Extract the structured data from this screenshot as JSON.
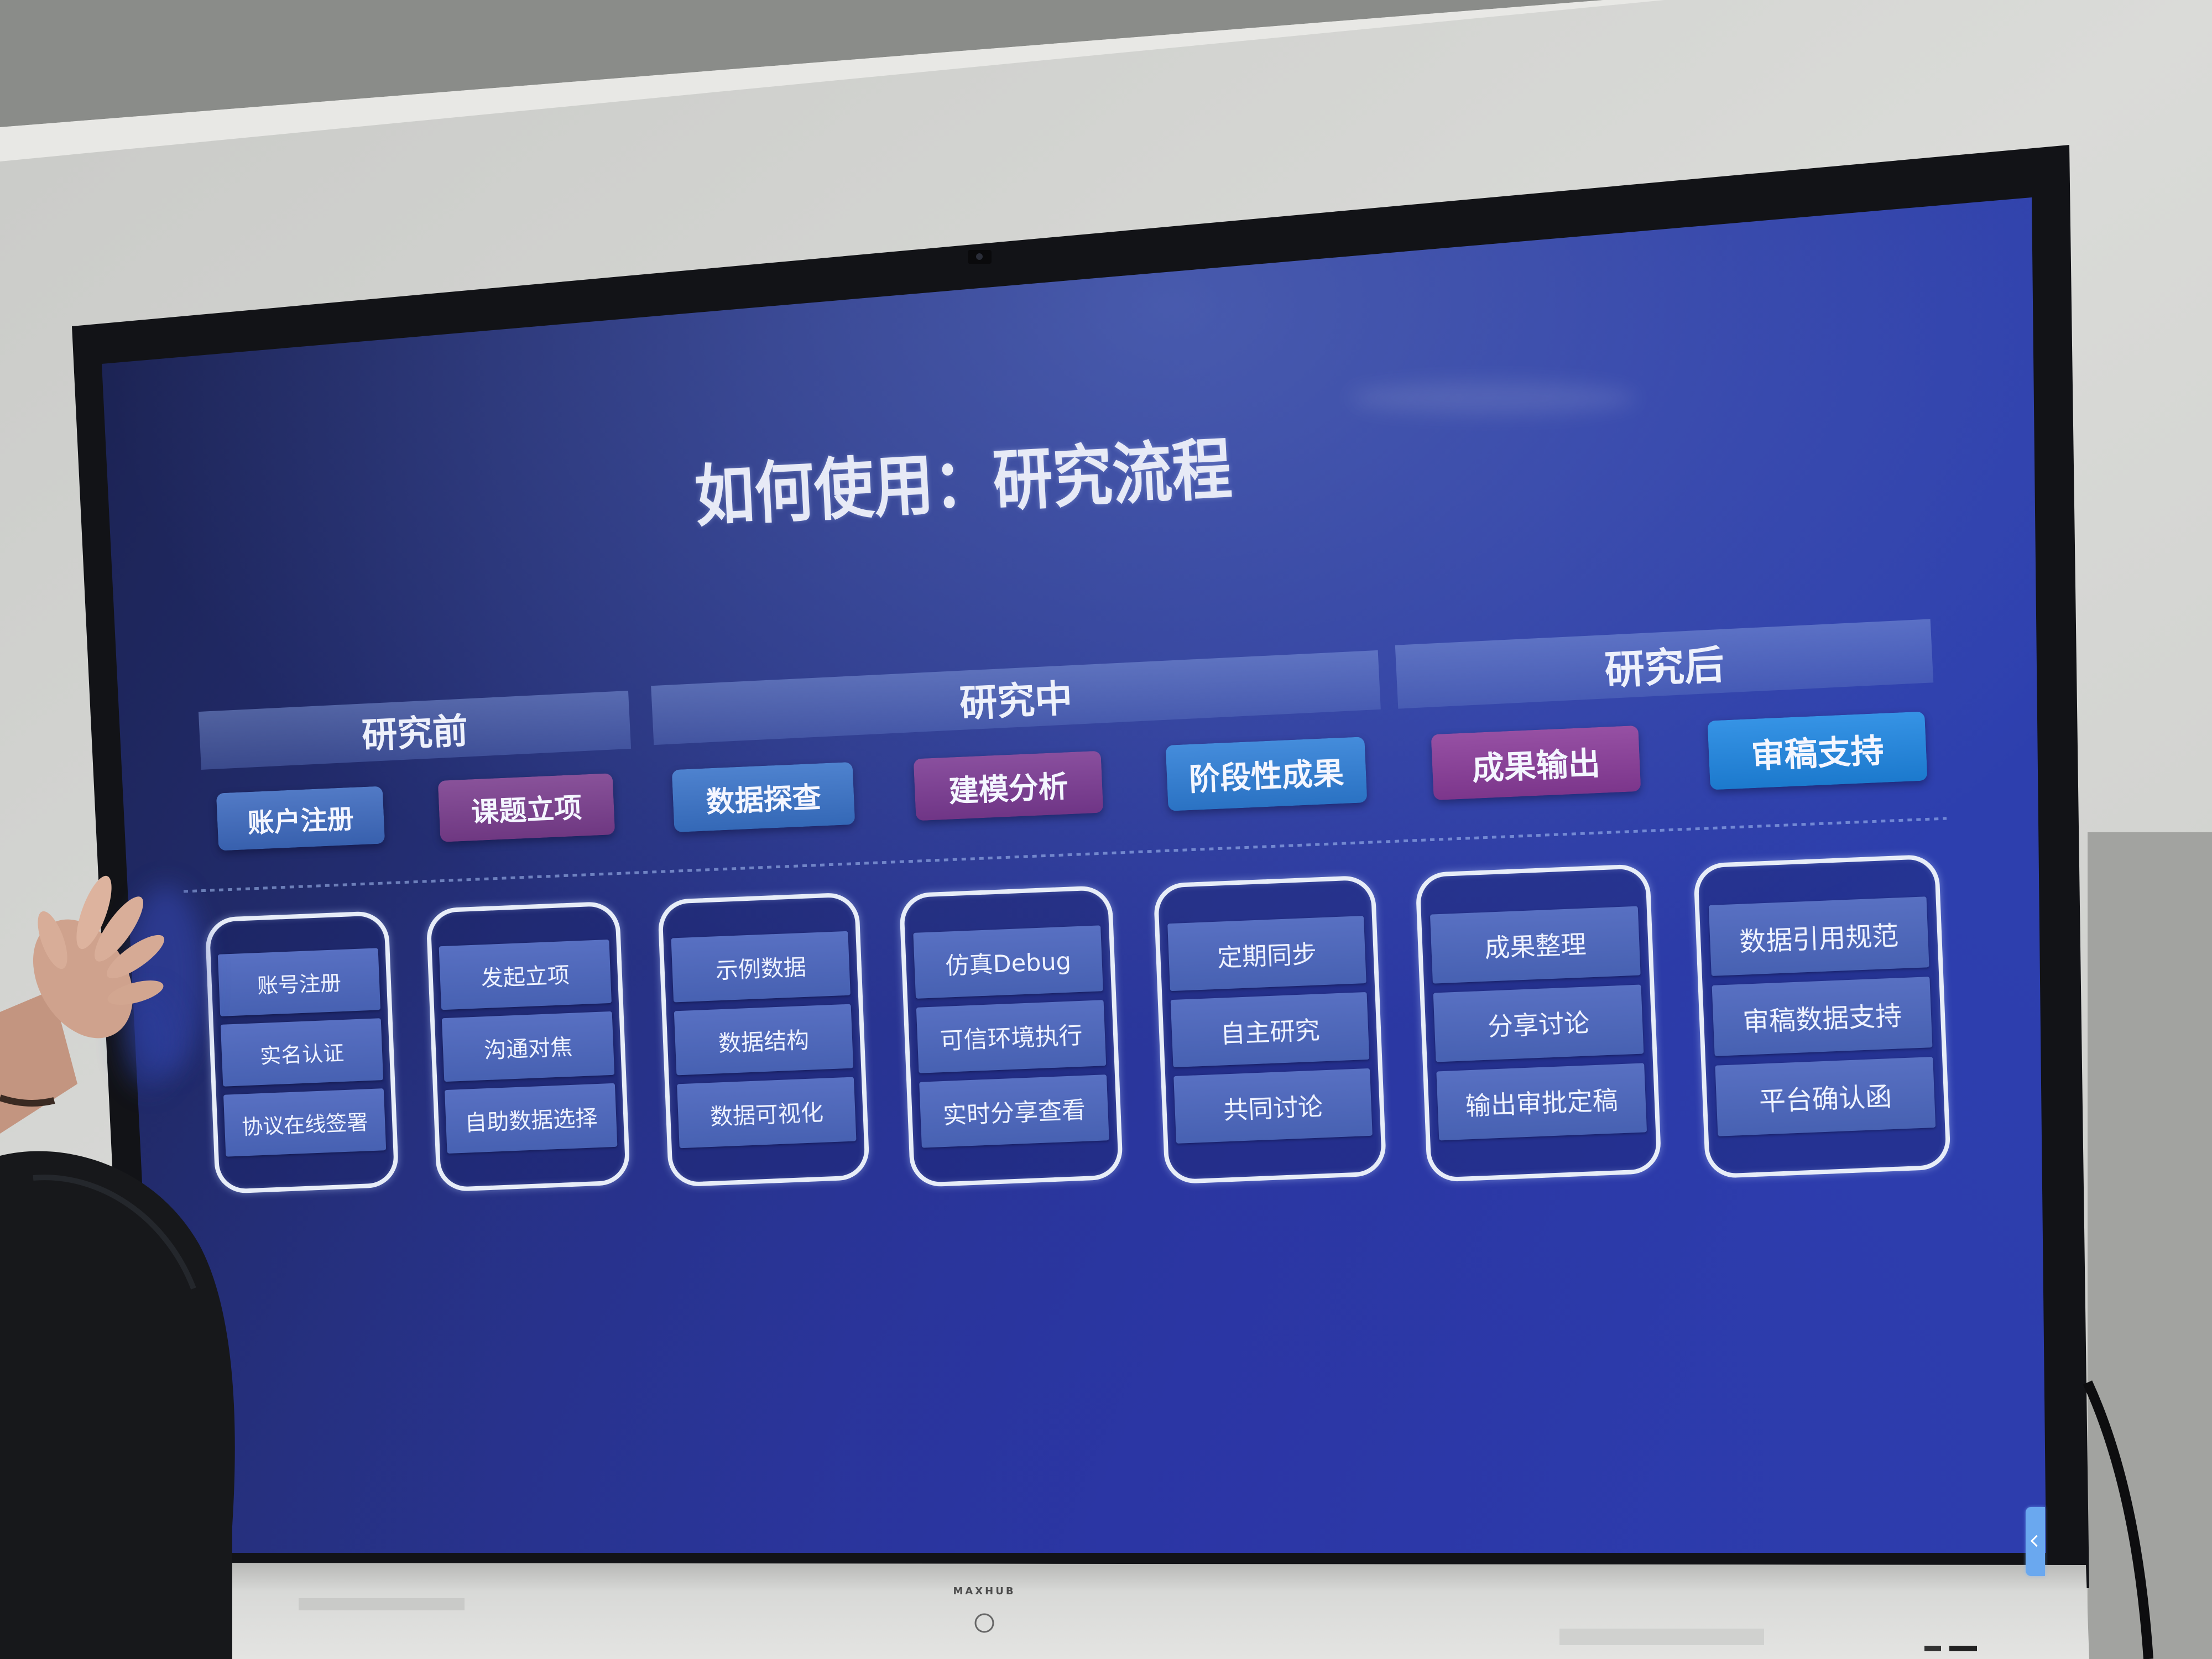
{
  "slide": {
    "title": "如何使用：研究流程",
    "phases": [
      {
        "label": "研究前"
      },
      {
        "label": "研究中"
      },
      {
        "label": "研究后"
      }
    ],
    "steps": [
      {
        "label": "账户注册",
        "color": "#3e6bbf"
      },
      {
        "label": "课题立项",
        "color": "#7b3e8e"
      },
      {
        "label": "数据探查",
        "color": "#3a74c9"
      },
      {
        "label": "建模分析",
        "color": "#7c3b93"
      },
      {
        "label": "阶段性成果",
        "color": "#2f7fd7"
      },
      {
        "label": "成果输出",
        "color": "#8a3c99"
      },
      {
        "label": "审稿支持",
        "color": "#1f87e2"
      }
    ],
    "cards": [
      {
        "items": [
          "账号注册",
          "实名认证",
          "协议在线签署"
        ]
      },
      {
        "items": [
          "发起立项",
          "沟通对焦",
          "自助数据选择"
        ]
      },
      {
        "items": [
          "示例数据",
          "数据结构",
          "数据可视化"
        ]
      },
      {
        "items": [
          "仿真Debug",
          "可信环境执行",
          "实时分享查看"
        ]
      },
      {
        "items": [
          "定期同步",
          "自主研究",
          "共同讨论"
        ]
      },
      {
        "items": [
          "成果整理",
          "分享讨论",
          "输出审批定稿"
        ]
      },
      {
        "items": [
          "数据引用规范",
          "审稿数据支持",
          "平台确认函"
        ]
      }
    ]
  },
  "display": {
    "brand": "MAXHUB"
  },
  "colors": {
    "screen_background": "#27328a",
    "phase_band": "#5a72c0",
    "card_outline": "#e7edf8",
    "item_fill": "#4e67b8",
    "side_tab": "#6aa8ef"
  }
}
